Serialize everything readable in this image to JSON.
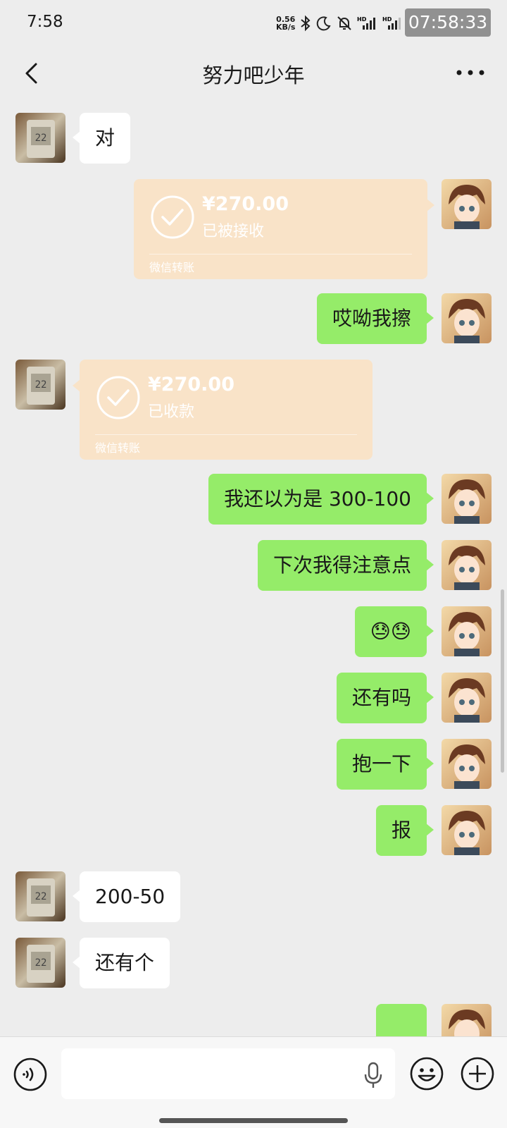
{
  "status_bar": {
    "time": "7:58",
    "net_speed_value": "0.56",
    "net_speed_unit": "KB/s",
    "overlay_time": "07:58:33"
  },
  "header": {
    "title": "努力吧少年"
  },
  "messages": [
    {
      "side": "left",
      "type": "text",
      "text": "对"
    },
    {
      "side": "right",
      "type": "transfer",
      "amount": "¥270.00",
      "status": "已被接收",
      "label": "微信转账"
    },
    {
      "side": "right",
      "type": "text",
      "text": "哎呦我擦"
    },
    {
      "side": "left",
      "type": "transfer",
      "amount": "¥270.00",
      "status": "已收款",
      "label": "微信转账"
    },
    {
      "side": "right",
      "type": "text",
      "text": "我还以为是 300-100"
    },
    {
      "side": "right",
      "type": "text",
      "text": "下次我得注意点"
    },
    {
      "side": "right",
      "type": "emoji",
      "text": "😓😓"
    },
    {
      "side": "right",
      "type": "text",
      "text": "还有吗"
    },
    {
      "side": "right",
      "type": "text",
      "text": "抱一下"
    },
    {
      "side": "right",
      "type": "text",
      "text": "报"
    },
    {
      "side": "left",
      "type": "text",
      "text": "200-50"
    },
    {
      "side": "left",
      "type": "text",
      "text": "还有个"
    }
  ],
  "input": {
    "value": "",
    "placeholder": ""
  },
  "colors": {
    "background": "#ededed",
    "sent_bubble": "#95ec69",
    "received_bubble": "#ffffff",
    "transfer_card": "#f9e3c8"
  },
  "icons": {
    "back": "chevron-left-icon",
    "more": "more-dots-icon",
    "voice": "voice-toggle-icon",
    "mic": "microphone-icon",
    "emoji": "emoji-face-icon",
    "add": "plus-circle-icon",
    "transfer_done": "check-circle-icon"
  }
}
